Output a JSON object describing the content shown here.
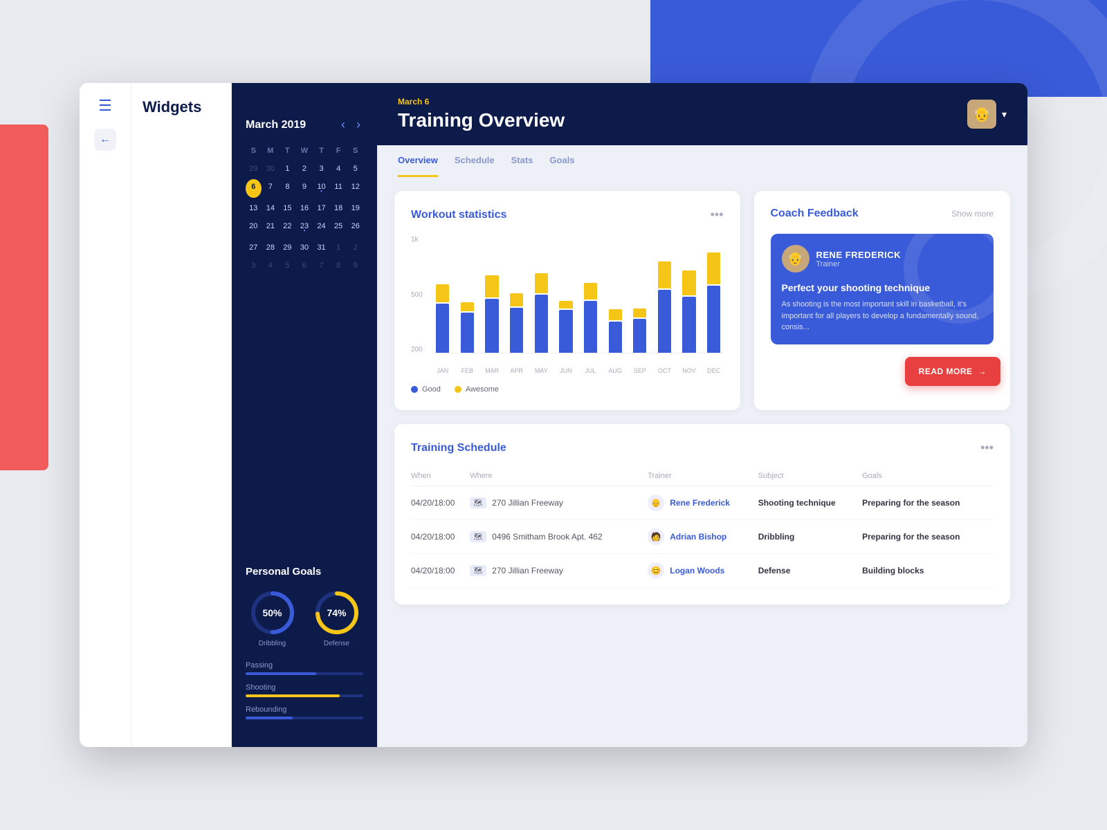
{
  "app": {
    "title": "Widgets",
    "back_label": "←"
  },
  "header": {
    "date": "March 6",
    "title": "Training Overview",
    "avatar_emoji": "👴"
  },
  "tabs": [
    {
      "label": "Overview",
      "active": true
    },
    {
      "label": "Schedule",
      "active": false
    },
    {
      "label": "Stats",
      "active": false
    },
    {
      "label": "Goals",
      "active": false
    }
  ],
  "calendar": {
    "title": "March 2019",
    "day_headers": [
      "S",
      "M",
      "T",
      "W",
      "T",
      "F",
      "S"
    ],
    "weeks": [
      [
        {
          "n": "29",
          "cls": "other-month"
        },
        {
          "n": "30",
          "cls": "other-month"
        },
        {
          "n": "1",
          "cls": "current-month"
        },
        {
          "n": "2",
          "cls": "current-month"
        },
        {
          "n": "3",
          "cls": "current-month"
        },
        {
          "n": "4",
          "cls": "current-month"
        },
        {
          "n": "5",
          "cls": "current-month"
        }
      ],
      [
        {
          "n": "6",
          "cls": "active"
        },
        {
          "n": "7",
          "cls": "current-month"
        },
        {
          "n": "8",
          "cls": "current-month"
        },
        {
          "n": "9",
          "cls": "current-month"
        },
        {
          "n": "10",
          "cls": "current-month has-dot"
        },
        {
          "n": "11",
          "cls": "current-month"
        },
        {
          "n": "12",
          "cls": "current-month"
        }
      ],
      [
        {
          "n": "13",
          "cls": "current-month"
        },
        {
          "n": "14",
          "cls": "current-month"
        },
        {
          "n": "15",
          "cls": "current-month"
        },
        {
          "n": "16",
          "cls": "current-month"
        },
        {
          "n": "17",
          "cls": "current-month"
        },
        {
          "n": "18",
          "cls": "current-month"
        },
        {
          "n": "19",
          "cls": "current-month"
        }
      ],
      [
        {
          "n": "20",
          "cls": "current-month"
        },
        {
          "n": "21",
          "cls": "current-month"
        },
        {
          "n": "22",
          "cls": "current-month"
        },
        {
          "n": "23",
          "cls": "current-month has-dot"
        },
        {
          "n": "24",
          "cls": "current-month"
        },
        {
          "n": "25",
          "cls": "current-month"
        },
        {
          "n": "26",
          "cls": "current-month"
        }
      ],
      [
        {
          "n": "27",
          "cls": "current-month"
        },
        {
          "n": "28",
          "cls": "current-month"
        },
        {
          "n": "29",
          "cls": "current-month"
        },
        {
          "n": "30",
          "cls": "current-month"
        },
        {
          "n": "31",
          "cls": "current-month"
        },
        {
          "n": "1",
          "cls": "other-month"
        },
        {
          "n": "2",
          "cls": "other-month"
        }
      ],
      [
        {
          "n": "3",
          "cls": "other-month"
        },
        {
          "n": "4",
          "cls": "other-month"
        },
        {
          "n": "5",
          "cls": "other-month"
        },
        {
          "n": "6",
          "cls": "other-month"
        },
        {
          "n": "7",
          "cls": "other-month"
        },
        {
          "n": "8",
          "cls": "other-month"
        },
        {
          "n": "9",
          "cls": "other-month"
        }
      ]
    ]
  },
  "personal_goals": {
    "title": "Personal Goals",
    "circles": [
      {
        "pct": "50%",
        "label": "Dribbling",
        "value": 50,
        "color": "#3a5bd9"
      },
      {
        "pct": "74%",
        "label": "Defense",
        "value": 74,
        "color": "#f5c518"
      }
    ],
    "bars": [
      {
        "label": "Passing",
        "pct": 60,
        "color": "#3a5bd9"
      },
      {
        "label": "Shooting",
        "pct": 80,
        "color": "#f5c518"
      },
      {
        "label": "Rebounding",
        "pct": 40,
        "color": "#3a5bd9"
      }
    ]
  },
  "workout_stats": {
    "title": "Workout statistics",
    "y_labels": [
      "1k",
      "500",
      "200"
    ],
    "months": [
      "JAN",
      "FEB",
      "MAR",
      "APR",
      "MAY",
      "JUN",
      "JUL",
      "AUG",
      "SEP",
      "OCT",
      "NOV",
      "DEC"
    ],
    "bars": [
      {
        "good": 55,
        "awesome": 20
      },
      {
        "good": 45,
        "awesome": 10
      },
      {
        "good": 60,
        "awesome": 25
      },
      {
        "good": 50,
        "awesome": 15
      },
      {
        "good": 65,
        "awesome": 22
      },
      {
        "good": 48,
        "awesome": 8
      },
      {
        "good": 58,
        "awesome": 18
      },
      {
        "good": 35,
        "awesome": 12
      },
      {
        "good": 38,
        "awesome": 10
      },
      {
        "good": 70,
        "awesome": 30
      },
      {
        "good": 62,
        "awesome": 28
      },
      {
        "good": 75,
        "awesome": 35
      }
    ],
    "legend": [
      {
        "label": "Good",
        "color": "#3a5bd9"
      },
      {
        "label": "Awesome",
        "color": "#f5c518"
      }
    ]
  },
  "coach_feedback": {
    "title": "Coach Feedback",
    "show_more": "Show more",
    "coach_name": "RENE FREDERICK",
    "coach_role": "Trainer",
    "coach_avatar": "👴",
    "feedback_title": "Perfect your shooting technique",
    "feedback_text": "As shooting is the most important skill in basketball, it's important for all players to develop a fundamentally sound, consis...",
    "read_more": "READ MORE"
  },
  "schedule": {
    "title": "Training Schedule",
    "columns": [
      "When",
      "Where",
      "Trainer",
      "Subject",
      "Goals"
    ],
    "rows": [
      {
        "when": "04/20/18:00",
        "where": "270 Jillian Freeway",
        "trainer": "Rene Frederick",
        "trainer_avatar": "👴",
        "trainer_color": "#e84040",
        "subject": "Shooting technique",
        "goals": "Preparing for the season"
      },
      {
        "when": "04/20/18:00",
        "where": "0496 Smitham Brook Apt. 462",
        "trainer": "Adrian Bishop",
        "trainer_avatar": "🧑",
        "trainer_color": "#f5a623",
        "subject": "Dribbling",
        "goals": "Preparing for the season"
      },
      {
        "when": "04/20/18:00",
        "where": "270 Jillian Freeway",
        "trainer": "Logan Woods",
        "trainer_avatar": "😊",
        "trainer_color": "#3a5bd9",
        "subject": "Defense",
        "goals": "Building blocks"
      }
    ]
  }
}
